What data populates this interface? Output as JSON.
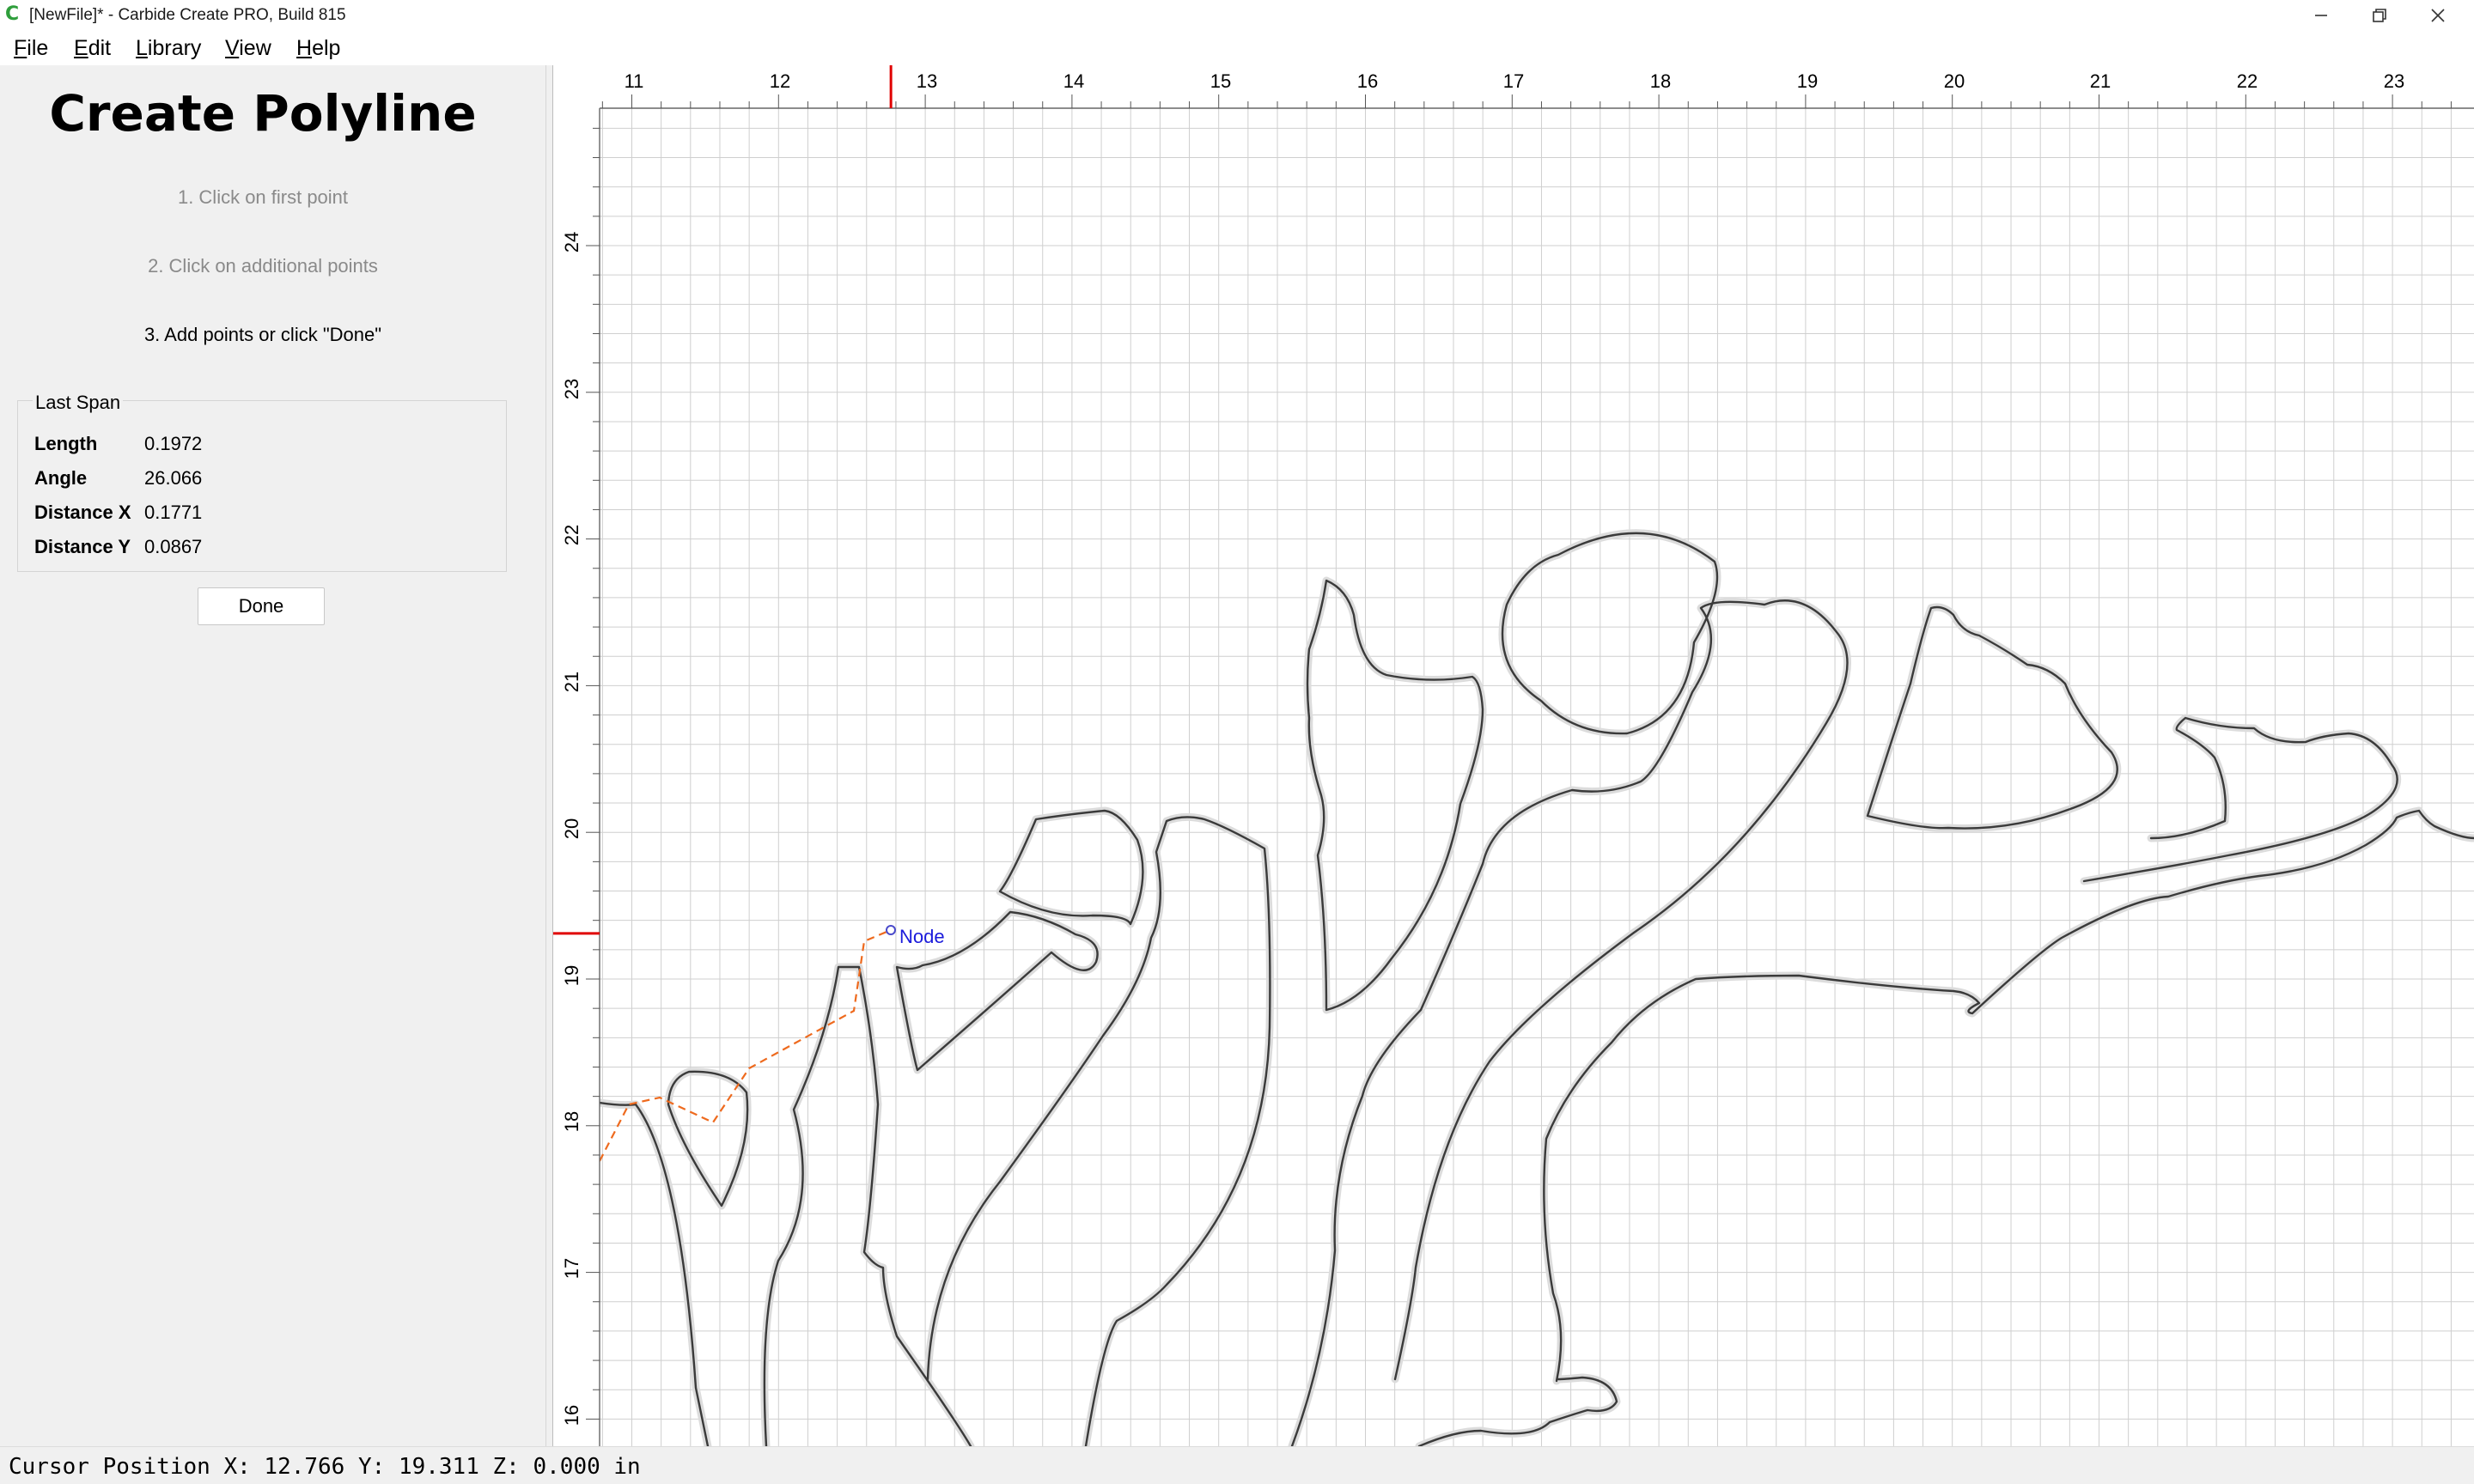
{
  "window": {
    "title": "[NewFile]* - Carbide Create PRO, Build 815",
    "app_icon": "carbide-create-icon",
    "controls": [
      "minimize-icon",
      "restore-icon",
      "close-icon"
    ]
  },
  "menu": {
    "items": [
      "File",
      "Edit",
      "Library",
      "View",
      "Help"
    ]
  },
  "panel": {
    "title": "Create Polyline",
    "steps": [
      {
        "text": "1. Click on first point",
        "state": "done"
      },
      {
        "text": "2. Click on additional points",
        "state": "done"
      },
      {
        "text": "3. Add points or click \"Done\"",
        "state": "current"
      }
    ],
    "last_span": {
      "title": "Last Span",
      "rows": [
        {
          "label": "Length",
          "value": "0.1972"
        },
        {
          "label": "Angle",
          "value": "26.066"
        },
        {
          "label": "Distance X",
          "value": "0.1771"
        },
        {
          "label": "Distance Y",
          "value": "0.0867"
        }
      ]
    },
    "done_label": "Done"
  },
  "canvas": {
    "units": "in",
    "x_ruler_labels": [
      "11",
      "12",
      "13",
      "14",
      "15",
      "16",
      "17",
      "18",
      "19",
      "20",
      "21",
      "22",
      "23"
    ],
    "y_ruler_labels": [
      "24",
      "23",
      "22",
      "21",
      "20",
      "19",
      "18",
      "17",
      "16"
    ],
    "cursor_marker": {
      "x": 12.766,
      "y": 19.311
    },
    "node_label": "Node",
    "colors": {
      "grid": "#c8c8c8",
      "ruler_marker": "#e00000",
      "outline": "#3a3a3a",
      "outline_halo": "#d9d9d9",
      "polyline": "#ee6a1e",
      "node_label": "#1a1adb"
    }
  },
  "status": {
    "cursor_position": "Cursor Position X: 12.766 Y: 19.311 Z: 0.000 in"
  }
}
